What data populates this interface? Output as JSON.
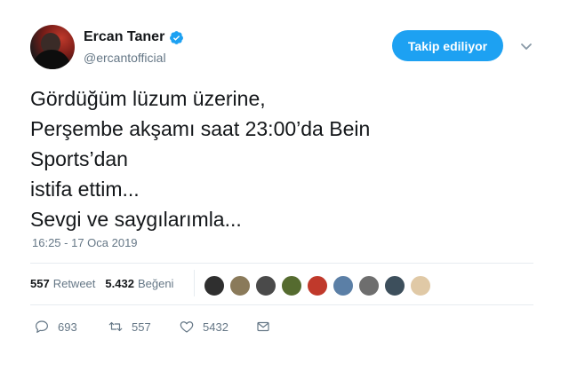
{
  "author": {
    "display_name": "Ercan Taner",
    "handle": "@ercantofficial",
    "verified_icon": "verified-badge-icon"
  },
  "follow_button": {
    "label": "Takip ediliyor"
  },
  "tweet": {
    "lines": [
      "Gördüğüm lüzum üzerine,",
      "Perşembe akşamı saat 23:00’da Bein",
      "Sports’dan",
      "istifa ettim...",
      "Sevgi ve saygılarımla..."
    ],
    "timestamp": "16:25 - 17 Oca 2019"
  },
  "stats": {
    "retweets_count": "557",
    "retweets_label": "Retweet",
    "likes_count": "5.432",
    "likes_label": "Beğeni"
  },
  "likers": [
    {
      "icon": "liker-avatar-1",
      "color": "#2f2f2f"
    },
    {
      "icon": "liker-avatar-2",
      "color": "#8a7a5a"
    },
    {
      "icon": "liker-avatar-3",
      "color": "#4a4a4a"
    },
    {
      "icon": "liker-avatar-4",
      "color": "#556b2f"
    },
    {
      "icon": "liker-avatar-5",
      "color": "#c0392b"
    },
    {
      "icon": "liker-avatar-6",
      "color": "#5b7fa6"
    },
    {
      "icon": "liker-avatar-7",
      "color": "#6e6e6e"
    },
    {
      "icon": "liker-avatar-8",
      "color": "#3d4f5c"
    },
    {
      "icon": "liker-avatar-9",
      "color": "#e0c9a6"
    }
  ],
  "actions": {
    "reply_count": "693",
    "retweet_count": "557",
    "like_count": "5432"
  },
  "colors": {
    "accent": "#1da1f2",
    "text": "#14171a",
    "muted": "#657786"
  }
}
